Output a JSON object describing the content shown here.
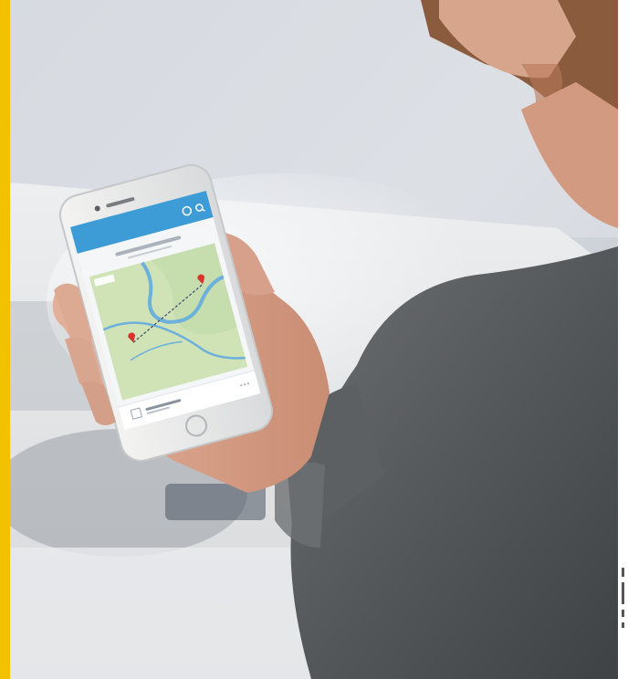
{
  "colors": {
    "accent_bar": "#f2c200",
    "app_header": "#3d9bd5",
    "map_land": "#cfe3b7",
    "map_water": "#6cb0dc",
    "route_line": "#3b4a6b",
    "pin": "#d9332b"
  },
  "phone_app": {
    "status_left": "",
    "status_right": "",
    "screen_title": "",
    "screen_subtitle": "",
    "footer_item_label": ""
  },
  "icons": {
    "header_refresh": "refresh-icon",
    "header_search": "search-icon",
    "pin_start": "map-pin-icon",
    "pin_end": "map-pin-icon",
    "footer_thumbnail": "image-icon",
    "footer_more": "more-icon",
    "home_button": "home-button-icon"
  }
}
